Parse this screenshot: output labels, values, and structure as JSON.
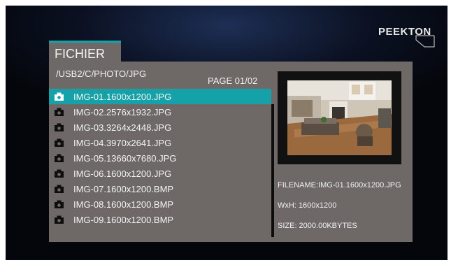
{
  "brand": {
    "logo_text": "PEEKTON"
  },
  "tab": {
    "label": "FICHIER"
  },
  "browser": {
    "path": "/USB2/C/PHOTO/JPG",
    "page_label": "PAGE 01/02",
    "files": [
      {
        "name": "IMG-01.1600x1200.JPG",
        "selected": true
      },
      {
        "name": "IMG-02.2576x1932.JPG"
      },
      {
        "name": "IMG-03.3264x2448.JPG"
      },
      {
        "name": "IMG-04.3970x2641.JPG"
      },
      {
        "name": "IMG-05.13660x7680.JPG"
      },
      {
        "name": "IMG-06.1600x1200.JPG"
      },
      {
        "name": "IMG-07.1600x1200.BMP"
      },
      {
        "name": "IMG-08.1600x1200.BMP"
      },
      {
        "name": "IMG-09.1600x1200.BMP"
      }
    ]
  },
  "preview": {
    "filename": "FILENAME:IMG-01.1600x1200.JPG",
    "dimensions": "WxH:  1600x1200",
    "size": "SIZE:  2000.00KBYTES"
  },
  "colors": {
    "accent": "#15a1a8",
    "panel": "#6e6866",
    "scrollbar": "#0d0d0f"
  },
  "icons": {
    "file": "camera-icon"
  }
}
